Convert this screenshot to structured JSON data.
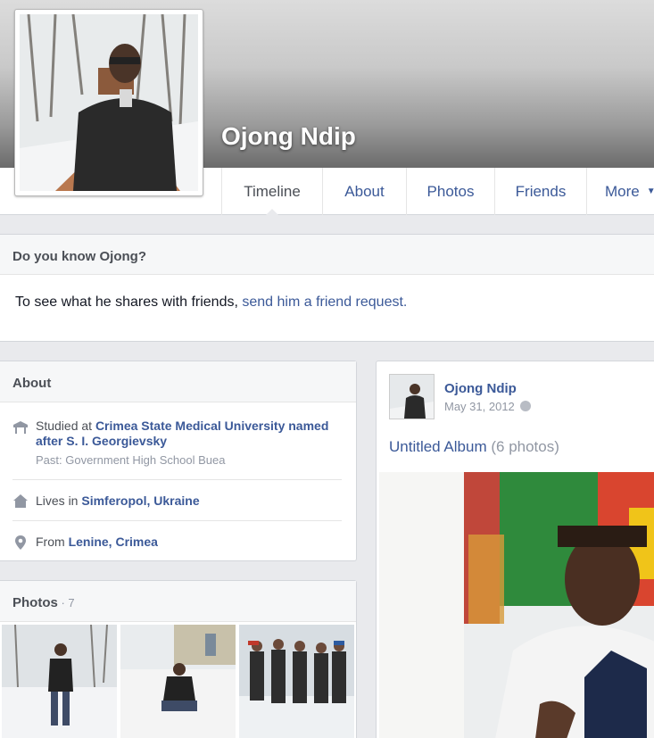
{
  "profile": {
    "name": "Ojong Ndip"
  },
  "nav": {
    "tabs": [
      {
        "label": "Timeline"
      },
      {
        "label": "About"
      },
      {
        "label": "Photos"
      },
      {
        "label": "Friends"
      },
      {
        "label": "More"
      }
    ]
  },
  "know": {
    "heading": "Do you know Ojong?",
    "prefix": "To see what he shares with friends, ",
    "link": "send him a friend request."
  },
  "about": {
    "heading": "About",
    "items": [
      {
        "icon": "school-icon",
        "prefix": "Studied at ",
        "value": "Crimea State Medical University named after S. I. Georgievsky",
        "sub": "Past: Government High School Buea"
      },
      {
        "icon": "home-icon",
        "prefix": "Lives in ",
        "value": "Simferopol, Ukraine"
      },
      {
        "icon": "location-pin-icon",
        "prefix": "From ",
        "value": "Lenine, Crimea"
      }
    ]
  },
  "photos": {
    "heading": "Photos",
    "count": " · 7"
  },
  "post": {
    "author": "Ojong Ndip",
    "date": "May 31, 2012",
    "album_title": "Untitled Album",
    "album_count": "(6 photos)"
  },
  "colors": {
    "link": "#3b5998",
    "background": "#e9eaed"
  }
}
